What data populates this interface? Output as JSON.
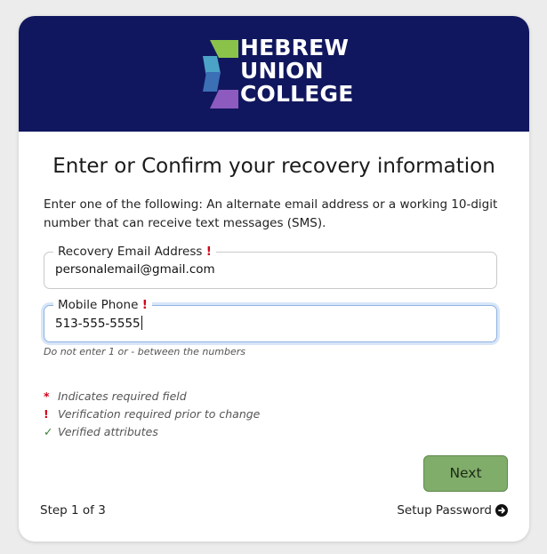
{
  "brand": {
    "logo_lines": [
      "HEBREW",
      "UNION",
      "COLLEGE"
    ],
    "banner_color": "#11175e"
  },
  "page": {
    "title": "Enter or Confirm your recovery information",
    "intro": "Enter one of the following: An alternate email address or a working 10-digit number that can receive text messages (SMS)."
  },
  "form": {
    "email": {
      "label": "Recovery Email Address",
      "required_mark": "!",
      "value": "personalemail@gmail.com"
    },
    "phone": {
      "label": "Mobile Phone",
      "required_mark": "!",
      "value": "513-555-5555",
      "hint": "Do not enter 1 or - between the numbers"
    }
  },
  "legend": {
    "required": {
      "symbol": "*",
      "text": "Indicates required field"
    },
    "verification": {
      "symbol": "!",
      "text": "Verification required prior to change"
    },
    "verified": {
      "symbol": "✓",
      "text": "Verified attributes"
    }
  },
  "actions": {
    "next_label": "Next",
    "step_text": "Step 1 of 3",
    "setup_link": "Setup Password",
    "next_color": "#80ad6a"
  }
}
